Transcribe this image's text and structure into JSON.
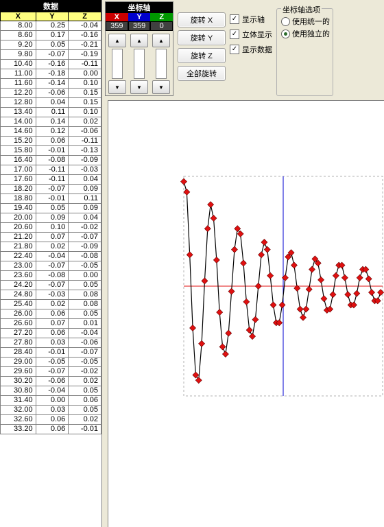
{
  "data_panel": {
    "title": "数据",
    "cols": [
      "X",
      "Y",
      "Z"
    ],
    "rows": [
      [
        8.0,
        0.25,
        -0.04
      ],
      [
        8.6,
        0.17,
        -0.16
      ],
      [
        9.2,
        0.05,
        -0.21
      ],
      [
        9.8,
        -0.07,
        -0.19
      ],
      [
        10.4,
        -0.16,
        -0.11
      ],
      [
        11.0,
        -0.18,
        0.0
      ],
      [
        11.6,
        -0.14,
        0.1
      ],
      [
        12.2,
        -0.06,
        0.15
      ],
      [
        12.8,
        0.04,
        0.15
      ],
      [
        13.4,
        0.11,
        0.1
      ],
      [
        14.0,
        0.14,
        0.02
      ],
      [
        14.6,
        0.12,
        -0.06
      ],
      [
        15.2,
        0.06,
        -0.11
      ],
      [
        15.8,
        -0.01,
        -0.13
      ],
      [
        16.4,
        -0.08,
        -0.09
      ],
      [
        17.0,
        -0.11,
        -0.03
      ],
      [
        17.6,
        -0.11,
        0.04
      ],
      [
        18.2,
        -0.07,
        0.09
      ],
      [
        18.8,
        -0.01,
        0.11
      ],
      [
        19.4,
        0.05,
        0.09
      ],
      [
        20.0,
        0.09,
        0.04
      ],
      [
        20.6,
        0.1,
        -0.02
      ],
      [
        21.2,
        0.07,
        -0.07
      ],
      [
        21.8,
        0.02,
        -0.09
      ],
      [
        22.4,
        -0.04,
        -0.08
      ],
      [
        23.0,
        -0.07,
        -0.05
      ],
      [
        23.6,
        -0.08,
        0.0
      ],
      [
        24.2,
        -0.07,
        0.05
      ],
      [
        24.8,
        -0.03,
        0.08
      ],
      [
        25.4,
        0.02,
        0.08
      ],
      [
        26.0,
        0.06,
        0.05
      ],
      [
        26.6,
        0.07,
        0.01
      ],
      [
        27.2,
        0.06,
        -0.04
      ],
      [
        27.8,
        0.03,
        -0.06
      ],
      [
        28.4,
        -0.01,
        -0.07
      ],
      [
        29.0,
        -0.05,
        -0.05
      ],
      [
        29.6,
        -0.07,
        -0.02
      ],
      [
        30.2,
        -0.06,
        0.02
      ],
      [
        30.8,
        -0.04,
        0.05
      ],
      [
        31.4,
        0.0,
        0.06
      ],
      [
        32.0,
        0.03,
        0.05
      ],
      [
        32.6,
        0.06,
        0.02
      ],
      [
        33.2,
        0.06,
        -0.01
      ]
    ]
  },
  "axis_panel": {
    "title": "坐标轴",
    "labels": {
      "x": "X",
      "y": "Y",
      "z": "Z"
    },
    "values": {
      "x": "359",
      "y": "359",
      "z": "0"
    }
  },
  "buttons": {
    "rot_x": "旋转 X",
    "rot_y": "旋转 Y",
    "rot_z": "旋转 Z",
    "rot_all": "全部旋转"
  },
  "checks": {
    "show_axis": "显示轴",
    "solid": "立体显示",
    "show_data": "显示数据"
  },
  "group": {
    "title": "坐标轴选项",
    "opt_unified": "使用统一的",
    "opt_independent": "使用独立的"
  },
  "chart_data": {
    "type": "line",
    "title": "",
    "xlabel": "",
    "ylabel": "",
    "xlim": [
      0,
      40
    ],
    "ylim": [
      -1.05,
      1.05
    ],
    "series": [
      {
        "name": "series1",
        "marker": "diamond",
        "color": "#e01010",
        "x": [
          0.0,
          0.6,
          1.2,
          1.8,
          2.4,
          3.0,
          3.6,
          4.2,
          4.8,
          5.4,
          6.0,
          6.6,
          7.2,
          7.8,
          8.4,
          9.0,
          9.6,
          10.2,
          10.8,
          11.4,
          12.0,
          12.6,
          13.2,
          13.8,
          14.4,
          15.0,
          15.6,
          16.2,
          16.8,
          17.4,
          18.0,
          18.6,
          19.2,
          19.8,
          20.4,
          21.0,
          21.6,
          22.2,
          22.8,
          23.4,
          24.0,
          24.6,
          25.2,
          25.8,
          26.4,
          27.0,
          27.6,
          28.2,
          28.8,
          29.4,
          30.0,
          30.6,
          31.2,
          31.8,
          32.4,
          33.0,
          33.6,
          34.2,
          34.8,
          35.4,
          36.0,
          36.6,
          37.2,
          37.8,
          38.4,
          39.0,
          39.6
        ],
        "y": [
          1.0,
          0.9,
          0.3,
          -0.4,
          -0.85,
          -0.9,
          -0.55,
          0.05,
          0.55,
          0.78,
          0.65,
          0.25,
          -0.25,
          -0.58,
          -0.65,
          -0.45,
          -0.05,
          0.35,
          0.55,
          0.5,
          0.22,
          -0.15,
          -0.42,
          -0.48,
          -0.32,
          0.0,
          0.3,
          0.42,
          0.35,
          0.1,
          -0.18,
          -0.35,
          -0.35,
          -0.18,
          0.08,
          0.28,
          0.32,
          0.2,
          -0.02,
          -0.22,
          -0.3,
          -0.22,
          -0.03,
          0.16,
          0.26,
          0.22,
          0.06,
          -0.12,
          -0.23,
          -0.22,
          -0.08,
          0.1,
          0.2,
          0.2,
          0.08,
          -0.08,
          -0.18,
          -0.18,
          -0.07,
          0.08,
          0.16,
          0.16,
          0.07,
          -0.06,
          -0.14,
          -0.14,
          -0.06
        ]
      }
    ],
    "vline_x": 20,
    "hline_y": 0
  }
}
